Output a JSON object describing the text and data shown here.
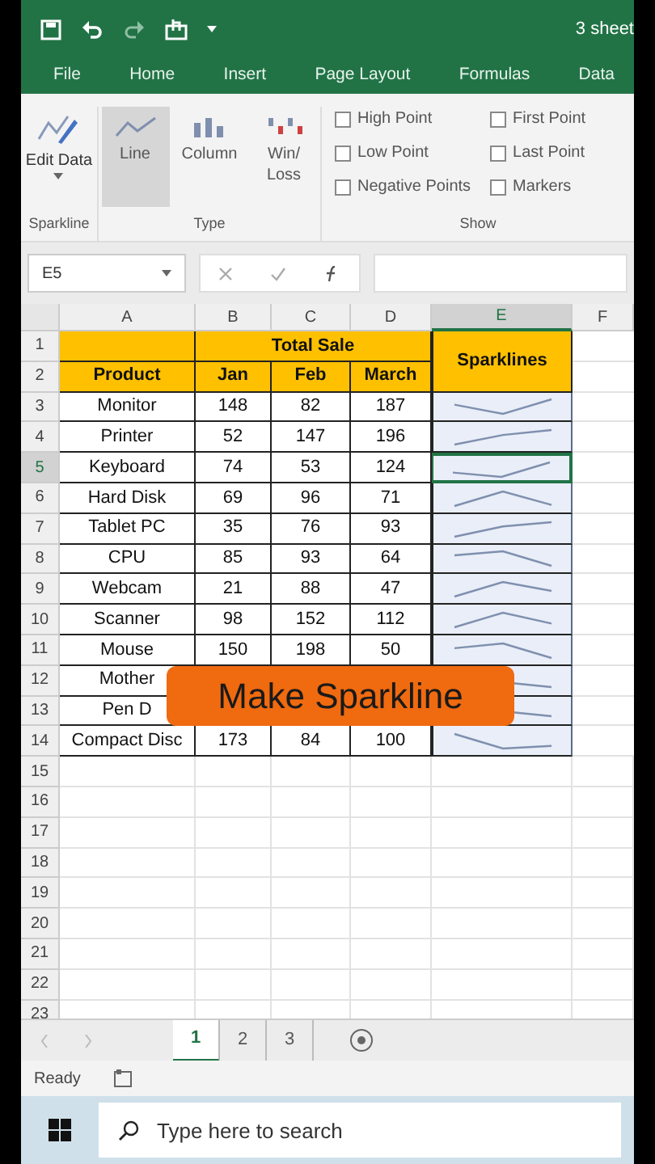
{
  "title_bar": {
    "title": "3 sheet"
  },
  "ribbon_tabs": [
    "File",
    "Home",
    "Insert",
    "Page Layout",
    "Formulas",
    "Data"
  ],
  "ribbon": {
    "sparkline_group": {
      "button": "Edit Data",
      "label": "Sparkline"
    },
    "type_group": {
      "label": "Type",
      "types": [
        {
          "label": "Line",
          "selected": true
        },
        {
          "label": "Column",
          "selected": false
        },
        {
          "label": "Win/ Loss",
          "selected": false
        }
      ]
    },
    "show_group": {
      "label": "Show",
      "options": [
        {
          "label": "High Point",
          "checked": false
        },
        {
          "label": "Low Point",
          "checked": false
        },
        {
          "label": "Negative Points",
          "checked": false
        },
        {
          "label": "First Point",
          "checked": false
        },
        {
          "label": "Last Point",
          "checked": false
        },
        {
          "label": "Markers",
          "checked": false
        }
      ]
    }
  },
  "name_box": "E5",
  "columns": [
    {
      "label": "A",
      "selected": false
    },
    {
      "label": "B",
      "selected": false
    },
    {
      "label": "C",
      "selected": false
    },
    {
      "label": "D",
      "selected": false
    },
    {
      "label": "E",
      "selected": true
    },
    {
      "label": "F",
      "selected": false
    }
  ],
  "header": {
    "row_numbers": [
      "1",
      "2"
    ],
    "title": "Total Sale",
    "sparklines": "Sparklines",
    "product": "Product",
    "months": [
      "Jan",
      "Feb",
      "March"
    ]
  },
  "rows": [
    {
      "number": "3",
      "product": "Monitor",
      "values": [
        "148",
        "82",
        "187"
      ],
      "selected": false
    },
    {
      "number": "4",
      "product": "Printer",
      "values": [
        "52",
        "147",
        "196"
      ],
      "selected": false
    },
    {
      "number": "5",
      "product": "Keyboard",
      "values": [
        "74",
        "53",
        "124"
      ],
      "selected": true
    },
    {
      "number": "6",
      "product": "Hard Disk",
      "values": [
        "69",
        "96",
        "71"
      ],
      "selected": false
    },
    {
      "number": "7",
      "product": "Tablet PC",
      "values": [
        "35",
        "76",
        "93"
      ],
      "selected": false
    },
    {
      "number": "8",
      "product": "CPU",
      "values": [
        "85",
        "93",
        "64"
      ],
      "selected": false
    },
    {
      "number": "9",
      "product": "Webcam",
      "values": [
        "21",
        "88",
        "47"
      ],
      "selected": false
    },
    {
      "number": "10",
      "product": "Scanner",
      "values": [
        "98",
        "152",
        "112"
      ],
      "selected": false
    },
    {
      "number": "11",
      "product": "Mouse",
      "values": [
        "150",
        "198",
        "50"
      ],
      "selected": false
    },
    {
      "number": "12",
      "product": "Mother",
      "values": [],
      "selected": false
    },
    {
      "number": "13",
      "product": "Pen D",
      "values": [],
      "selected": false
    },
    {
      "number": "14",
      "product": "Compact Disc",
      "values": [
        "173",
        "84",
        "100"
      ],
      "selected": false
    }
  ],
  "empty_rows": [
    "15",
    "16",
    "17",
    "18",
    "19",
    "20",
    "21",
    "22",
    "23"
  ],
  "caption": "Make Sparkline",
  "sheet_tabs": [
    {
      "label": "1",
      "selected": true
    },
    {
      "label": "2",
      "selected": false
    },
    {
      "label": "3",
      "selected": false
    }
  ],
  "status": "Ready",
  "taskbar": {
    "placeholder": "Type here to search"
  }
}
